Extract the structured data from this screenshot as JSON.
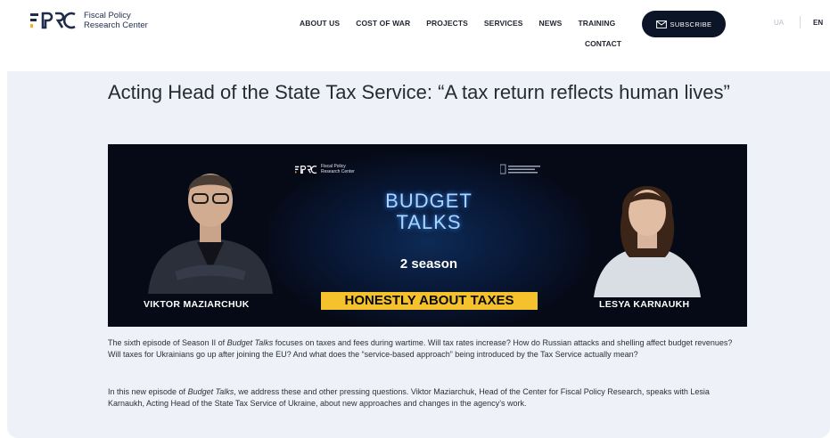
{
  "header": {
    "logo_text_line1": "Fiscal Policy",
    "logo_text_line2": "Research Center",
    "nav": [
      "ABOUT US",
      "COST OF WAR",
      "PROJECTS",
      "SERVICES",
      "NEWS",
      "TRAINING"
    ],
    "nav_contact": "CONTACT",
    "subscribe_label": "SUBSCRIBE",
    "lang_ua": "UA",
    "lang_en": "EN"
  },
  "article": {
    "title": "Acting Head of the State Tax Service: “A tax return reflects human lives”",
    "banner": {
      "logo_line1": "Fiscal Policy",
      "logo_line2": "Research Center",
      "budget_line1": "BUDGET",
      "budget_line2": "TALKS",
      "season": "2 season",
      "tagline": "HONESTLY ABOUT TAXES",
      "left_name": "VIKTOR MAZIARCHUK",
      "right_name": "LESYA KARNAUKH"
    },
    "p1_a": "The sixth episode of Season II of ",
    "p1_em": "Budget Talks",
    "p1_b": " focuses on taxes and fees during wartime. Will tax rates increase? How do Russian attacks and shelling affect budget revenues? Will taxes for Ukrainians go up after joining the EU? And what does the “service-based approach” being introduced by the Tax Service actually mean?",
    "p2_a": "In this new episode of ",
    "p2_em": "Budget Talks",
    "p2_b": ", we address these and other pressing questions. Viktor Maziarchuk, Head of the Center for Fiscal Policy Research, speaks with Lesia Karnaukh, Acting Head of the State Tax Service of Ukraine, about new approaches and changes in the agency’s work."
  },
  "colors": {
    "accent_dark": "#0c1427",
    "banner_yellow": "#f5c22d",
    "card_bg": "#eef2f8"
  }
}
